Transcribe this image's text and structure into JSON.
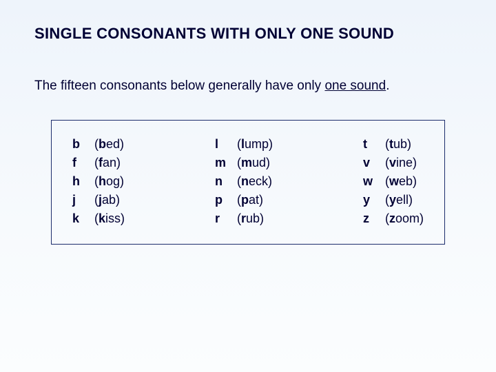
{
  "title": "SINGLE CONSONANTS WITH ONLY ONE SOUND",
  "intro_prefix": "The fifteen consonants below generally have only ",
  "intro_underline": "one sound",
  "intro_suffix": ".",
  "columns": [
    [
      {
        "letter": "b",
        "bold": "b",
        "rest": "ed"
      },
      {
        "letter": "f",
        "bold": "f",
        "rest": "an"
      },
      {
        "letter": "h",
        "bold": "h",
        "rest": "og"
      },
      {
        "letter": "j",
        "bold": "j",
        "rest": "ab"
      },
      {
        "letter": "k",
        "bold": "k",
        "rest": "iss"
      }
    ],
    [
      {
        "letter": "l",
        "bold": "l",
        "rest": "ump"
      },
      {
        "letter": "m",
        "bold": "m",
        "rest": "ud"
      },
      {
        "letter": "n",
        "bold": "n",
        "rest": "eck"
      },
      {
        "letter": "p",
        "bold": "p",
        "rest": "at"
      },
      {
        "letter": "r",
        "bold": "r",
        "rest": "ub"
      }
    ],
    [
      {
        "letter": "t",
        "bold": "t",
        "rest": "ub"
      },
      {
        "letter": "v",
        "bold": "v",
        "rest": "ine"
      },
      {
        "letter": "w",
        "bold": "w",
        "rest": "eb"
      },
      {
        "letter": "y",
        "bold": "y",
        "rest": "ell"
      },
      {
        "letter": "z",
        "bold": "z",
        "rest": "oom"
      }
    ]
  ]
}
